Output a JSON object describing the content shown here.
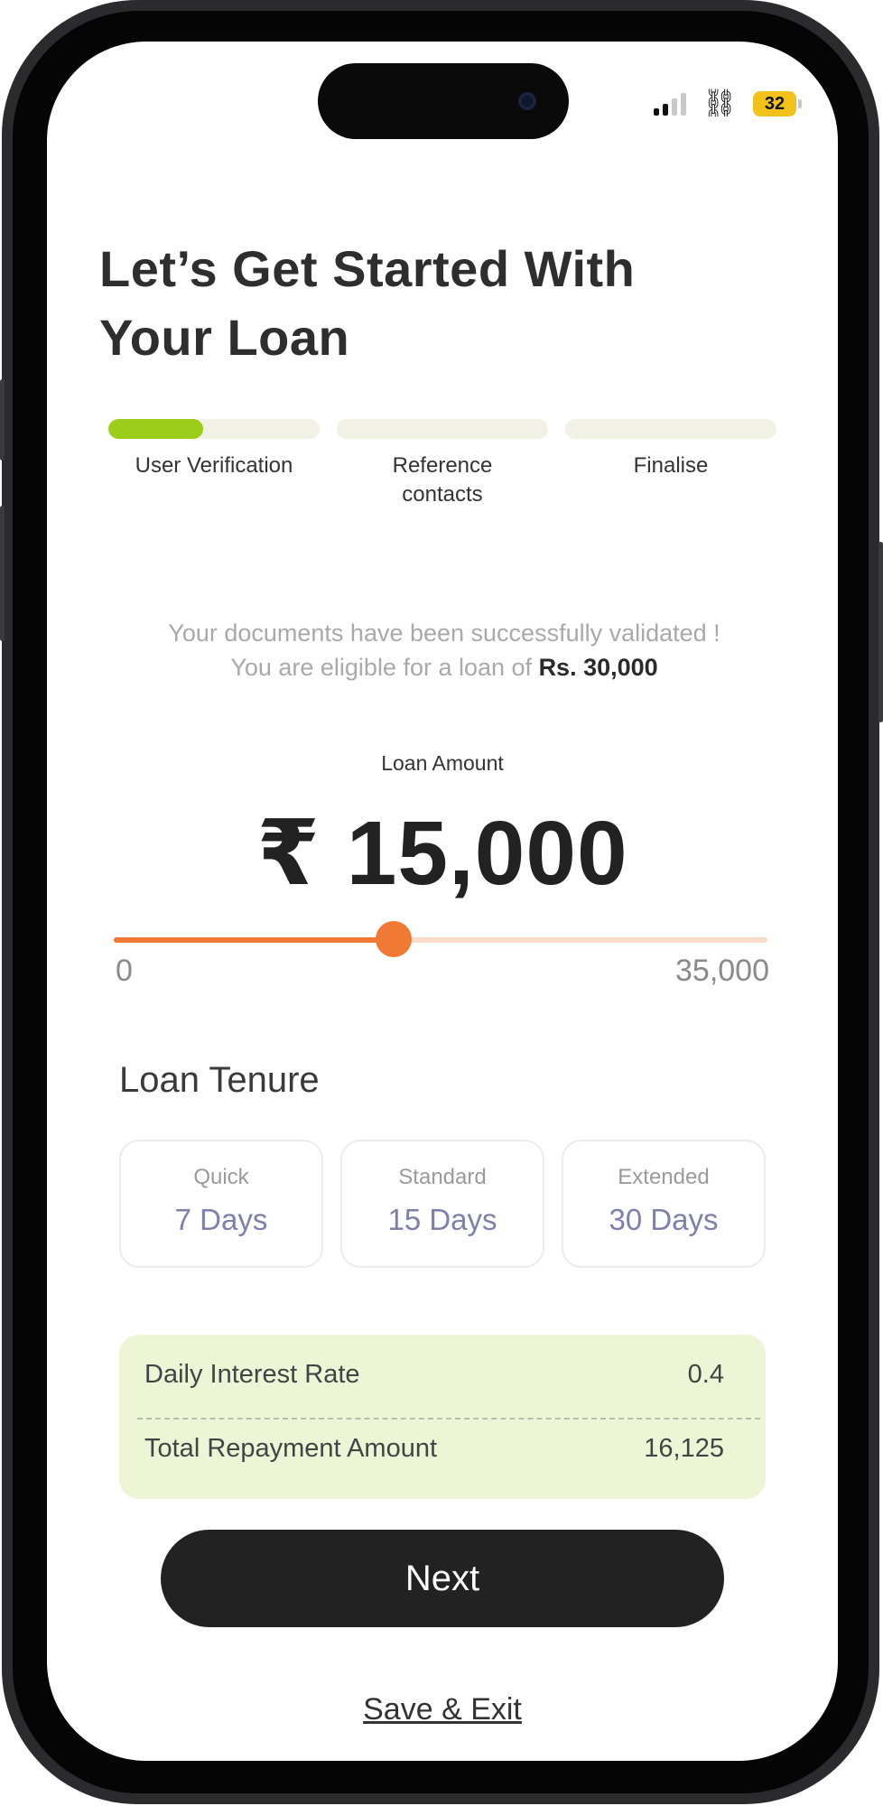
{
  "status_bar": {
    "battery": "32",
    "icons": [
      "signal-icon",
      "link-icon",
      "battery-icon"
    ]
  },
  "header": {
    "title_line1": "Let’s Get Started With",
    "title_line2": "Your Loan"
  },
  "steps": [
    {
      "label": "User Verification",
      "progress": 0.45
    },
    {
      "label_line1": "Reference",
      "label_line2": "contacts",
      "progress": 0
    },
    {
      "label": "Finalise",
      "progress": 0
    }
  ],
  "eligibility": {
    "line1": "Your documents have been successfully validated !",
    "line2_prefix": "You are eligible for a loan of ",
    "line2_amount": "Rs. 30,000"
  },
  "loan_amount": {
    "label": "Loan Amount",
    "value": "₹ 15,000",
    "slider_min": "0",
    "slider_max": "35,000",
    "slider_value": 15000
  },
  "tenure": {
    "title": "Loan Tenure",
    "options": [
      {
        "name": "Quick",
        "days": "7 Days"
      },
      {
        "name": "Standard",
        "days": "15 Days"
      },
      {
        "name": "Extended",
        "days": "30 Days"
      }
    ]
  },
  "summary": {
    "rate_label": "Daily Interest Rate",
    "rate_value": "0.4",
    "total_label": "Total Repayment Amount",
    "total_value": "16,125"
  },
  "actions": {
    "next": "Next",
    "save_exit": "Save & Exit"
  },
  "colors": {
    "accent_orange": "#f07a34",
    "progress_green": "#9ccd1a",
    "summary_bg": "#eef5d6",
    "days_text": "#7e7fab"
  }
}
